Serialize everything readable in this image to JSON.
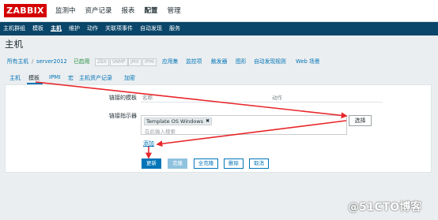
{
  "logo": "ZABBIX",
  "top_menu": [
    "监测中",
    "资产记录",
    "报表",
    "配置",
    "管理"
  ],
  "top_menu_active": 3,
  "sub_menu": [
    "主机群组",
    "模板",
    "主机",
    "维护",
    "动作",
    "关联项事件",
    "自动发现",
    "服务"
  ],
  "sub_menu_active": 2,
  "page_title": "主机",
  "host_bar": {
    "all_hosts": "所有主机",
    "separator": "/",
    "host_name": "server2012",
    "status": "已启用",
    "tags": [
      "ZBX",
      "SNMP",
      "JMX",
      "IPMI"
    ],
    "links": [
      "应用集",
      "监控项",
      "触发器",
      "图形",
      "自动发现规则",
      "Web 场景"
    ]
  },
  "tabs": [
    "主机",
    "模板",
    "IPMI",
    "宏",
    "主机资产记录",
    "加密"
  ],
  "tabs_active": 1,
  "form": {
    "linked_templates_label": "链接的模板",
    "col_name": "名称",
    "col_action": "动作",
    "link_indicator_label": "链接指示器",
    "selected_template": "Template OS Windows",
    "remove_glyph": "✖",
    "search_placeholder": "在此输入搜索",
    "select_button": "选择",
    "add_link": "添加"
  },
  "buttons": {
    "update": "更新",
    "clone": "克隆",
    "full_clone": "全克隆",
    "delete": "删除",
    "cancel": "取消"
  },
  "watermark": "@51CTO博客",
  "colors": {
    "brand_red": "#d40000",
    "nav_dark": "#0a466a",
    "link_blue": "#0275b8",
    "annotation_red": "#e8262a"
  }
}
